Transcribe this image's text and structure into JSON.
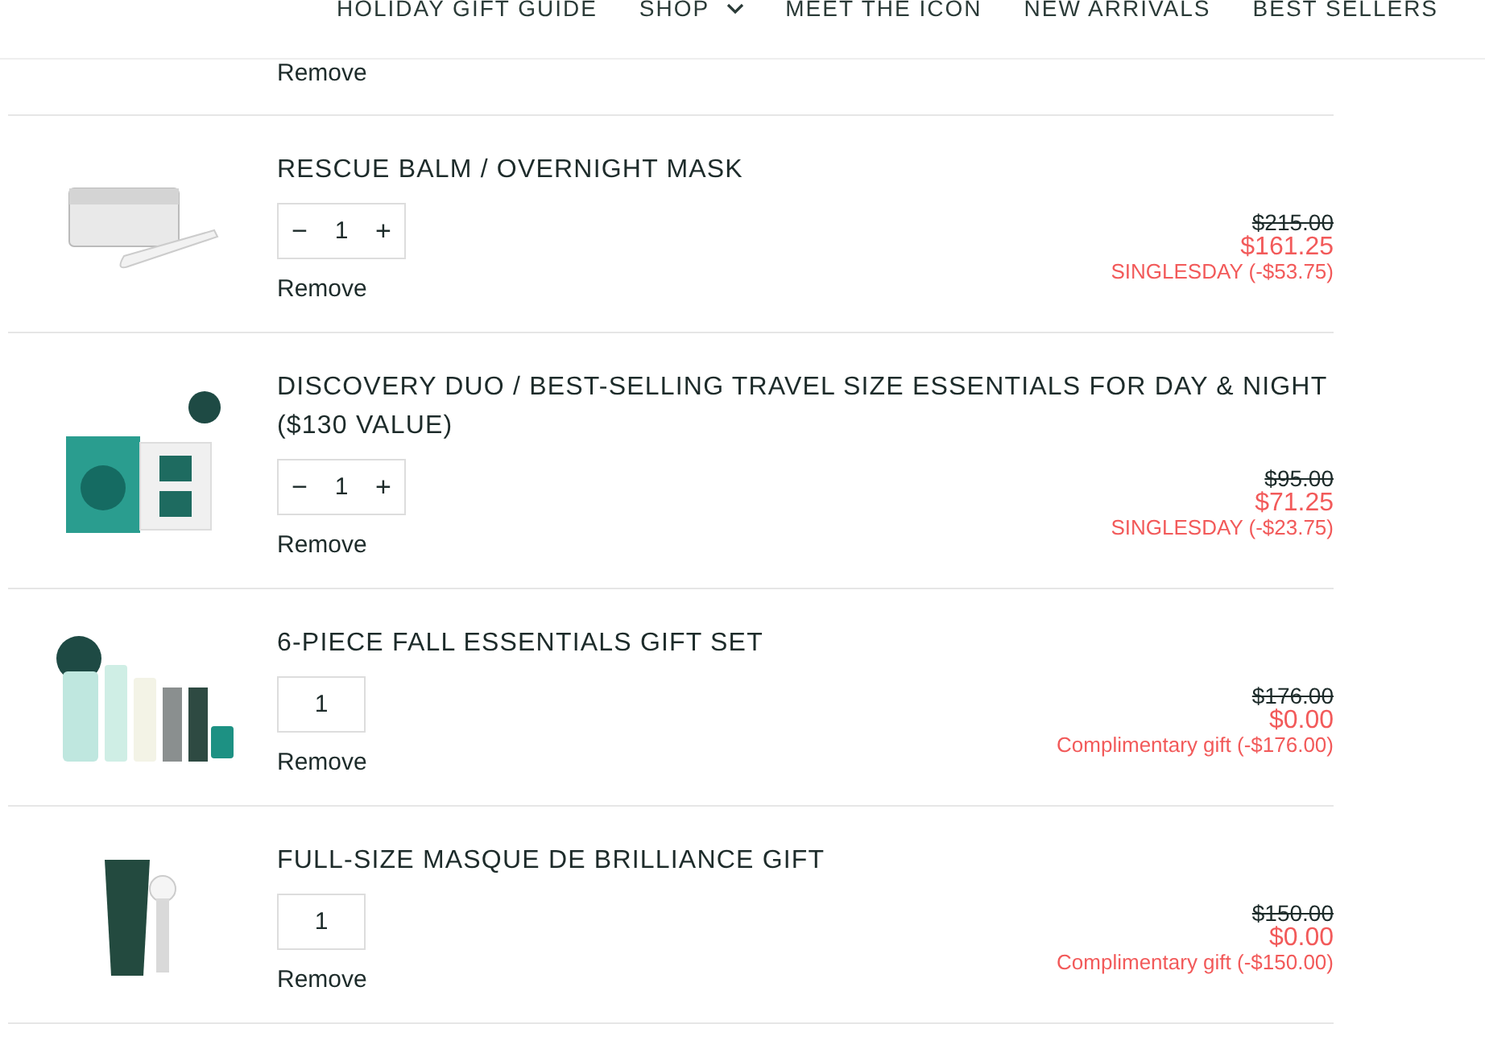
{
  "nav": {
    "items": [
      {
        "label": "HOLIDAY GIFT GUIDE",
        "dropdown": false
      },
      {
        "label": "SHOP",
        "dropdown": true
      },
      {
        "label": "MEET THE ICON",
        "dropdown": false
      },
      {
        "label": "NEW ARRIVALS",
        "dropdown": false
      },
      {
        "label": "BEST SELLERS",
        "dropdown": false
      }
    ]
  },
  "partial_item": {
    "remove": "Remove"
  },
  "items": [
    {
      "title": "RESCUE BALM / OVERNIGHT MASK",
      "quantity": {
        "kind": "stepper",
        "minus": "−",
        "value": "1",
        "plus": "+"
      },
      "remove": "Remove",
      "original_price": "$215.00",
      "price": "$161.25",
      "discount": "SINGLESDAY (-$53.75)"
    },
    {
      "title": "DISCOVERY DUO / BEST-SELLING TRAVEL SIZE ESSENTIALS FOR DAY & NIGHT ($130 VALUE)",
      "quantity": {
        "kind": "stepper",
        "minus": "−",
        "value": "1",
        "plus": "+"
      },
      "remove": "Remove",
      "original_price": "$95.00",
      "price": "$71.25",
      "discount": "SINGLESDAY (-$23.75)"
    },
    {
      "title": "6-PIECE FALL ESSENTIALS GIFT SET",
      "quantity": {
        "kind": "fixed",
        "value": "1"
      },
      "remove": "Remove",
      "original_price": "$176.00",
      "price": "$0.00",
      "discount": "Complimentary gift (-$176.00)"
    },
    {
      "title": "FULL-SIZE MASQUE DE BRILLIANCE GIFT",
      "quantity": {
        "kind": "fixed",
        "value": "1"
      },
      "remove": "Remove",
      "original_price": "$150.00",
      "price": "$0.00",
      "discount": "Complimentary gift (-$150.00)"
    }
  ]
}
